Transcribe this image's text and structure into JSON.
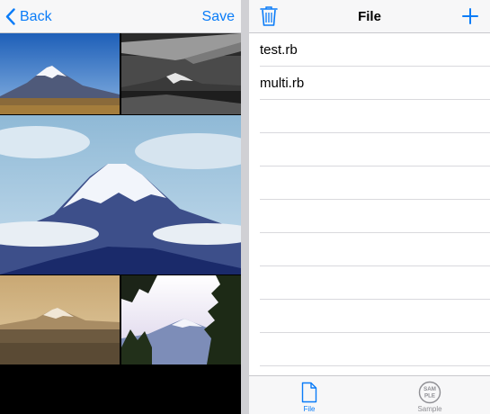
{
  "left_nav": {
    "back_label": "Back",
    "save_label": "Save"
  },
  "photos": [
    {
      "icon": "mountain-fuji-photo"
    },
    {
      "icon": "airplane-wing-mountain-photo"
    },
    {
      "icon": "mountain-fuji-large-photo"
    },
    {
      "icon": "mountain-sepia-photo"
    },
    {
      "icon": "mountain-trees-photo"
    }
  ],
  "right_nav": {
    "title": "File",
    "trash_icon": "trash-icon",
    "add_icon": "plus-icon"
  },
  "files": [
    "test.rb",
    "multi.rb"
  ],
  "tabs": [
    {
      "label": "File",
      "icon": "document-icon",
      "active": true
    },
    {
      "label": "Sample",
      "icon": "sample-badge-icon",
      "badge_text": "SAMPLE",
      "active": false
    }
  ],
  "colors": {
    "accent": "#0a7cf8",
    "inactive": "#8e8e93",
    "nav_bg": "#f7f7f8"
  }
}
